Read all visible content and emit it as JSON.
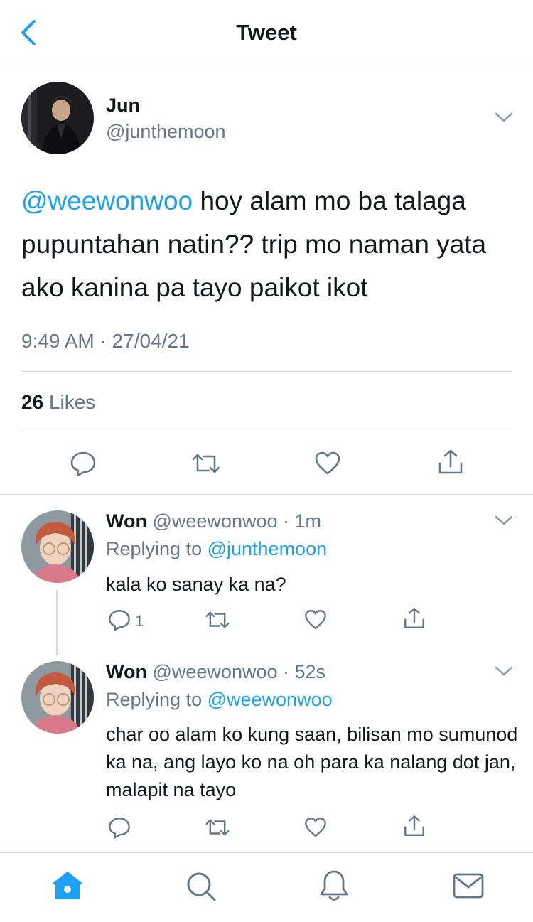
{
  "header": {
    "title": "Tweet"
  },
  "tweet": {
    "author_name": "Jun",
    "author_handle": "@junthemoon",
    "mention": "@weewonwoo",
    "text": " hoy alam mo ba talaga pupuntahan natin?? trip mo naman yata ako kanina pa tayo paikot ikot",
    "timestamp": "9:49 AM · 27/04/21",
    "likes_count": "26",
    "likes_label": "Likes"
  },
  "replies": [
    {
      "name": "Won",
      "meta": " @weewonwoo · 1m",
      "replying_label": "Replying to ",
      "replying_to": "@junthemoon",
      "text": "kala ko sanay ka na?",
      "reply_count": "1"
    },
    {
      "name": "Won",
      "meta": " @weewonwoo · 52s",
      "replying_label": "Replying to ",
      "replying_to": "@weewonwoo",
      "text": "char oo alam ko kung saan, bilisan mo sumunod ka na, ang layo ko na oh para ka nalang dot jan, malapit na tayo",
      "reply_count": ""
    }
  ],
  "icons": {
    "back": "chevron-left-icon",
    "more": "chevron-down-icon",
    "reply": "reply-icon",
    "retweet": "retweet-icon",
    "like": "heart-icon",
    "share": "share-icon",
    "home": "home-icon",
    "search": "search-icon",
    "notifications": "bell-icon",
    "messages": "mail-icon"
  },
  "colors": {
    "accent": "#1da1f2",
    "secondary_text": "#657786",
    "primary_text": "#14171a",
    "icon_gray": "#657786"
  }
}
